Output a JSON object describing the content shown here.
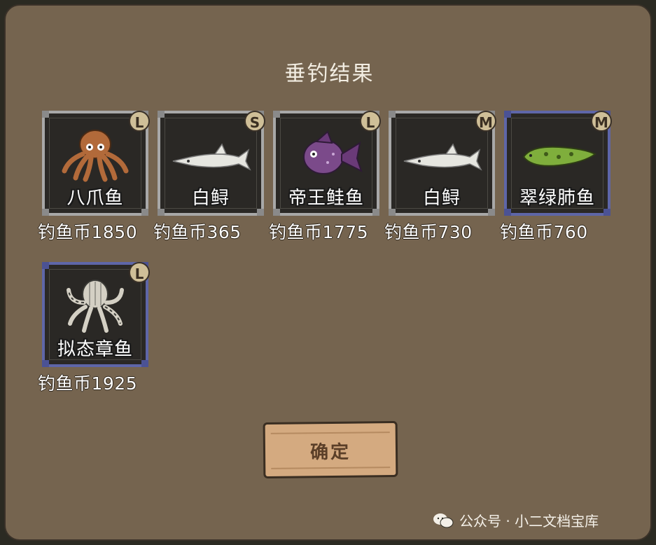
{
  "dialog": {
    "title": "垂钓结果",
    "confirm_label": "确定"
  },
  "catches": [
    {
      "name": "八爪鱼",
      "size": "L",
      "price": "钓鱼币1850",
      "frame": "gray",
      "icon": "octopus-icon"
    },
    {
      "name": "白鲟",
      "size": "S",
      "price": "钓鱼币365",
      "frame": "gray",
      "icon": "white-sturgeon-icon"
    },
    {
      "name": "帝王鲑鱼",
      "size": "L",
      "price": "钓鱼币1775",
      "frame": "gray",
      "icon": "king-salmon-icon"
    },
    {
      "name": "白鲟",
      "size": "M",
      "price": "钓鱼币730",
      "frame": "gray",
      "icon": "white-sturgeon-icon"
    },
    {
      "name": "翠绿肺鱼",
      "size": "M",
      "price": "钓鱼币760",
      "frame": "blue",
      "icon": "green-lungfish-icon"
    },
    {
      "name": "拟态章鱼",
      "size": "L",
      "price": "钓鱼币1925",
      "frame": "blue",
      "icon": "mimic-octopus-icon"
    }
  ],
  "watermark": {
    "text": "公众号 · 小二文档宝库"
  },
  "colors": {
    "panel": "#75644f",
    "frame_gray": "#a8a8a8",
    "frame_blue": "#5e66a8",
    "badge": "#cfbf98",
    "button": "#d4aa80"
  }
}
